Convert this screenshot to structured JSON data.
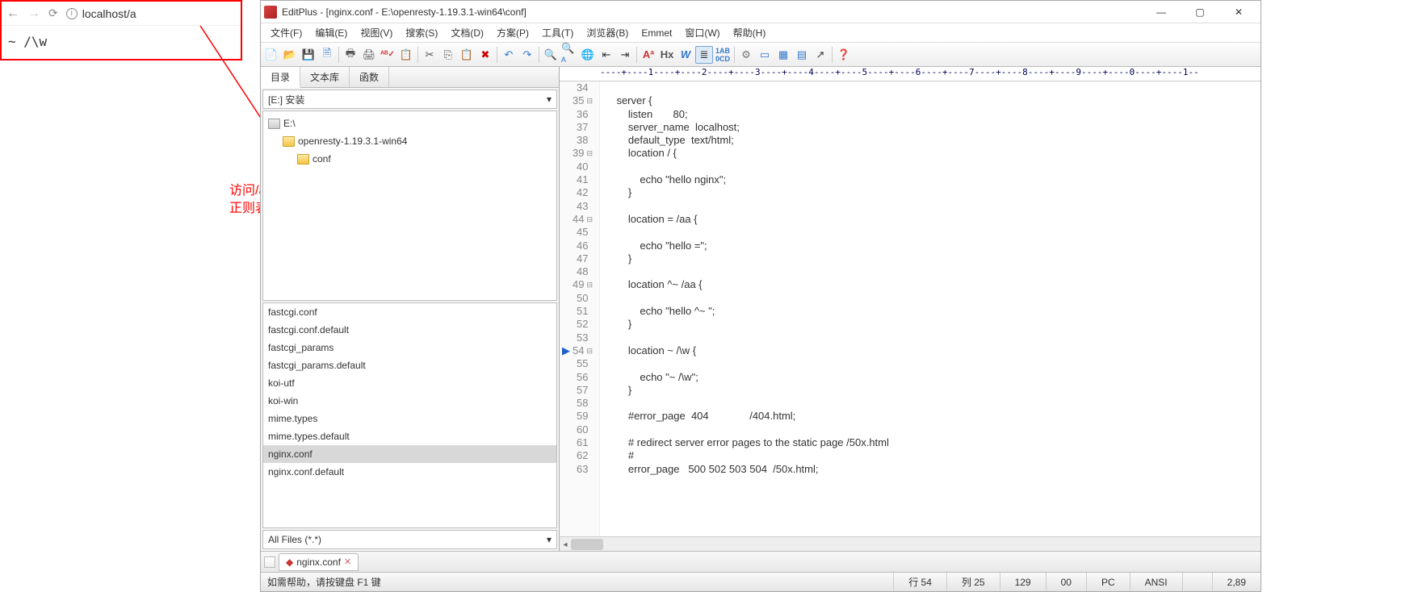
{
  "browser": {
    "url": "localhost/a",
    "body": "~ /\\w"
  },
  "annotation": {
    "line1": "访问/a此时精准匹配与第二优先级的模糊匹配不生效,",
    "line2": "正则表达式生效"
  },
  "editor": {
    "title": "EditPlus - [nginx.conf - E:\\openresty-1.19.3.1-win64\\conf]",
    "menus": [
      "文件(F)",
      "编辑(E)",
      "视图(V)",
      "搜索(S)",
      "文档(D)",
      "方案(P)",
      "工具(T)",
      "浏览器(B)",
      "Emmet",
      "窗口(W)",
      "帮助(H)"
    ],
    "panel_tabs": [
      "目录",
      "文本库",
      "函数"
    ],
    "drive": "[E:] 安装",
    "tree": [
      {
        "label": "E:\\",
        "icon": "drive",
        "indent": 0
      },
      {
        "label": "openresty-1.19.3.1-win64",
        "icon": "folder",
        "indent": 1
      },
      {
        "label": "conf",
        "icon": "folder",
        "indent": 2
      }
    ],
    "files": [
      "fastcgi.conf",
      "fastcgi.conf.default",
      "fastcgi_params",
      "fastcgi_params.default",
      "koi-utf",
      "koi-win",
      "mime.types",
      "mime.types.default",
      "nginx.conf",
      "nginx.conf.default"
    ],
    "selected_file": "nginx.conf",
    "filter": "All Files (*.*)",
    "open_tab": "nginx.conf",
    "ruler": "----+----1----+----2----+----3----+----4----+----5----+----6----+----7----+----8----+----9----+----0----+----1--",
    "code": {
      "start": 34,
      "lines": [
        {
          "n": 34,
          "t": "",
          "f": ""
        },
        {
          "n": 35,
          "t": "    server {",
          "f": "⊟"
        },
        {
          "n": 36,
          "t": "        listen       80;",
          "f": ""
        },
        {
          "n": 37,
          "t": "        server_name  localhost;",
          "f": ""
        },
        {
          "n": 38,
          "t": "        default_type  text/html;",
          "f": ""
        },
        {
          "n": 39,
          "t": "        location / {",
          "f": "⊟"
        },
        {
          "n": 40,
          "t": "",
          "f": ""
        },
        {
          "n": 41,
          "t": "            echo \"hello nginx\";",
          "f": ""
        },
        {
          "n": 42,
          "t": "        }",
          "f": ""
        },
        {
          "n": 43,
          "t": "",
          "f": ""
        },
        {
          "n": 44,
          "t": "        location = /aa {",
          "f": "⊟"
        },
        {
          "n": 45,
          "t": "",
          "f": ""
        },
        {
          "n": 46,
          "t": "            echo \"hello =\";",
          "f": ""
        },
        {
          "n": 47,
          "t": "        }",
          "f": ""
        },
        {
          "n": 48,
          "t": "",
          "f": ""
        },
        {
          "n": 49,
          "t": "        location ^~ /aa {",
          "f": "⊟"
        },
        {
          "n": 50,
          "t": "",
          "f": ""
        },
        {
          "n": 51,
          "t": "            echo \"hello ^~ \";",
          "f": ""
        },
        {
          "n": 52,
          "t": "        }",
          "f": ""
        },
        {
          "n": 53,
          "t": "",
          "f": ""
        },
        {
          "n": 54,
          "t": "        location ~ /\\w {",
          "f": "⊟",
          "current": true
        },
        {
          "n": 55,
          "t": "",
          "f": ""
        },
        {
          "n": 56,
          "t": "            echo \"~ /\\w\";",
          "f": ""
        },
        {
          "n": 57,
          "t": "        }",
          "f": ""
        },
        {
          "n": 58,
          "t": "",
          "f": ""
        },
        {
          "n": 59,
          "t": "        #error_page  404              /404.html;",
          "f": ""
        },
        {
          "n": 60,
          "t": "",
          "f": ""
        },
        {
          "n": 61,
          "t": "        # redirect server error pages to the static page /50x.html",
          "f": ""
        },
        {
          "n": 62,
          "t": "        #",
          "f": ""
        },
        {
          "n": 63,
          "t": "        error_page   500 502 503 504  /50x.html;",
          "f": ""
        }
      ]
    },
    "status": {
      "help": "如需帮助，请按键盘 F1 键",
      "line": "行 54",
      "col": "列 25",
      "c1": "129",
      "c2": "00",
      "mode": "PC",
      "enc": "ANSI",
      "size": "2,89"
    }
  }
}
